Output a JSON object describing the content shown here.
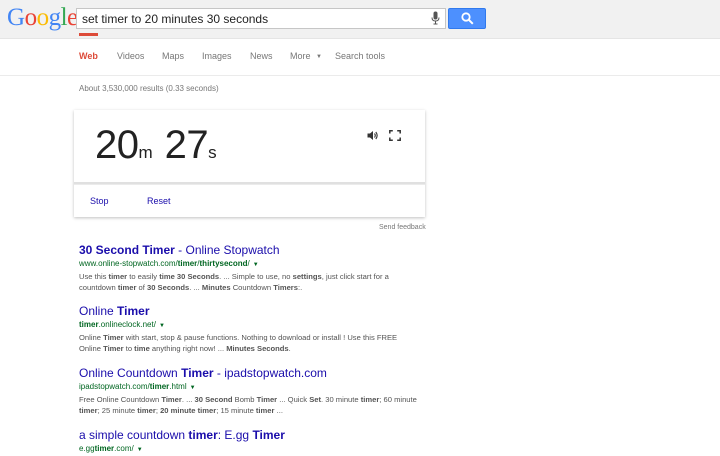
{
  "search": {
    "query": "set timer to 20 minutes 30 seconds"
  },
  "nav": {
    "tabs": [
      "Web",
      "Videos",
      "Maps",
      "Images",
      "News",
      "More",
      "Search tools"
    ]
  },
  "result_stats": "About 3,530,000 results (0.33 seconds)",
  "timer": {
    "minutes": "20",
    "minutes_unit": "m",
    "seconds": "27",
    "seconds_unit": "s",
    "stop_label": "Stop",
    "reset_label": "Reset"
  },
  "send_feedback": "Send feedback",
  "results": [
    {
      "title_parts": [
        [
          "b",
          "30 Second Timer"
        ],
        [
          "",
          " - Online Stopwatch"
        ]
      ],
      "url_parts": [
        [
          "",
          "www.online-stopwatch.com/"
        ],
        [
          "b",
          "timer"
        ],
        [
          "",
          "/"
        ],
        [
          "b",
          "thirtysecond"
        ],
        [
          "",
          "/"
        ]
      ],
      "snippet_parts": [
        [
          "",
          "Use this "
        ],
        [
          "b",
          "timer"
        ],
        [
          "",
          " to easily "
        ],
        [
          "b",
          "time 30 Seconds"
        ],
        [
          "",
          ". ... Simple to use, no "
        ],
        [
          "b",
          "settings"
        ],
        [
          "",
          ", just click start for a countdown "
        ],
        [
          "b",
          "timer"
        ],
        [
          "",
          " of "
        ],
        [
          "b",
          "30 Seconds"
        ],
        [
          "",
          ". ... "
        ],
        [
          "b",
          "Minutes"
        ],
        [
          "",
          " Countdown "
        ],
        [
          "b",
          "Timers"
        ],
        [
          "",
          ":."
        ]
      ]
    },
    {
      "title_parts": [
        [
          "",
          "Online "
        ],
        [
          "b",
          "Timer"
        ]
      ],
      "url_parts": [
        [
          "b",
          "timer"
        ],
        [
          "",
          ".onlineclock.net/"
        ]
      ],
      "snippet_parts": [
        [
          "",
          "Online "
        ],
        [
          "b",
          "Timer"
        ],
        [
          "",
          " with start, stop & pause functions. Nothing to download or install ! Use this FREE Online "
        ],
        [
          "b",
          "Timer"
        ],
        [
          "",
          " to "
        ],
        [
          "b",
          "time"
        ],
        [
          "",
          " anything right now! ... "
        ],
        [
          "b",
          "Minutes Seconds"
        ],
        [
          "",
          "."
        ]
      ]
    },
    {
      "title_parts": [
        [
          "",
          "Online Countdown "
        ],
        [
          "b",
          "Timer"
        ],
        [
          "",
          " - ipadstopwatch.com"
        ]
      ],
      "url_parts": [
        [
          "",
          "ipadstopwatch.com/"
        ],
        [
          "b",
          "timer"
        ],
        [
          "",
          ".html"
        ]
      ],
      "snippet_parts": [
        [
          "",
          "Free Online Countdown "
        ],
        [
          "b",
          "Timer"
        ],
        [
          "",
          ". ... "
        ],
        [
          "b",
          "30 Second"
        ],
        [
          "",
          " Bomb "
        ],
        [
          "b",
          "Timer"
        ],
        [
          "",
          " ... Quick "
        ],
        [
          "b",
          "Set"
        ],
        [
          "",
          ". 30 minute "
        ],
        [
          "b",
          "timer"
        ],
        [
          "",
          "; 60 minute "
        ],
        [
          "b",
          "timer"
        ],
        [
          "",
          "; 25 minute "
        ],
        [
          "b",
          "timer"
        ],
        [
          "",
          "; "
        ],
        [
          "b",
          "20 minute timer"
        ],
        [
          "",
          "; 15 minute "
        ],
        [
          "b",
          "timer"
        ],
        [
          "",
          " ..."
        ]
      ]
    },
    {
      "title_parts": [
        [
          "",
          "a simple countdown "
        ],
        [
          "b",
          "timer"
        ],
        [
          "",
          ": E.gg "
        ],
        [
          "b",
          "Timer"
        ]
      ],
      "url_parts": [
        [
          "",
          "e.gg"
        ],
        [
          "b",
          "timer"
        ],
        [
          "",
          ".com/"
        ]
      ],
      "snippet_parts": []
    }
  ],
  "colors": {
    "accent_red": "#dd4b39",
    "link_blue": "#1a0dab",
    "url_green": "#006621",
    "search_button_blue": "#4d90fe"
  },
  "icons": [
    "microphone-icon",
    "magnifier-icon",
    "sound-icon",
    "fullscreen-icon",
    "dropdown-caret-icon"
  ]
}
